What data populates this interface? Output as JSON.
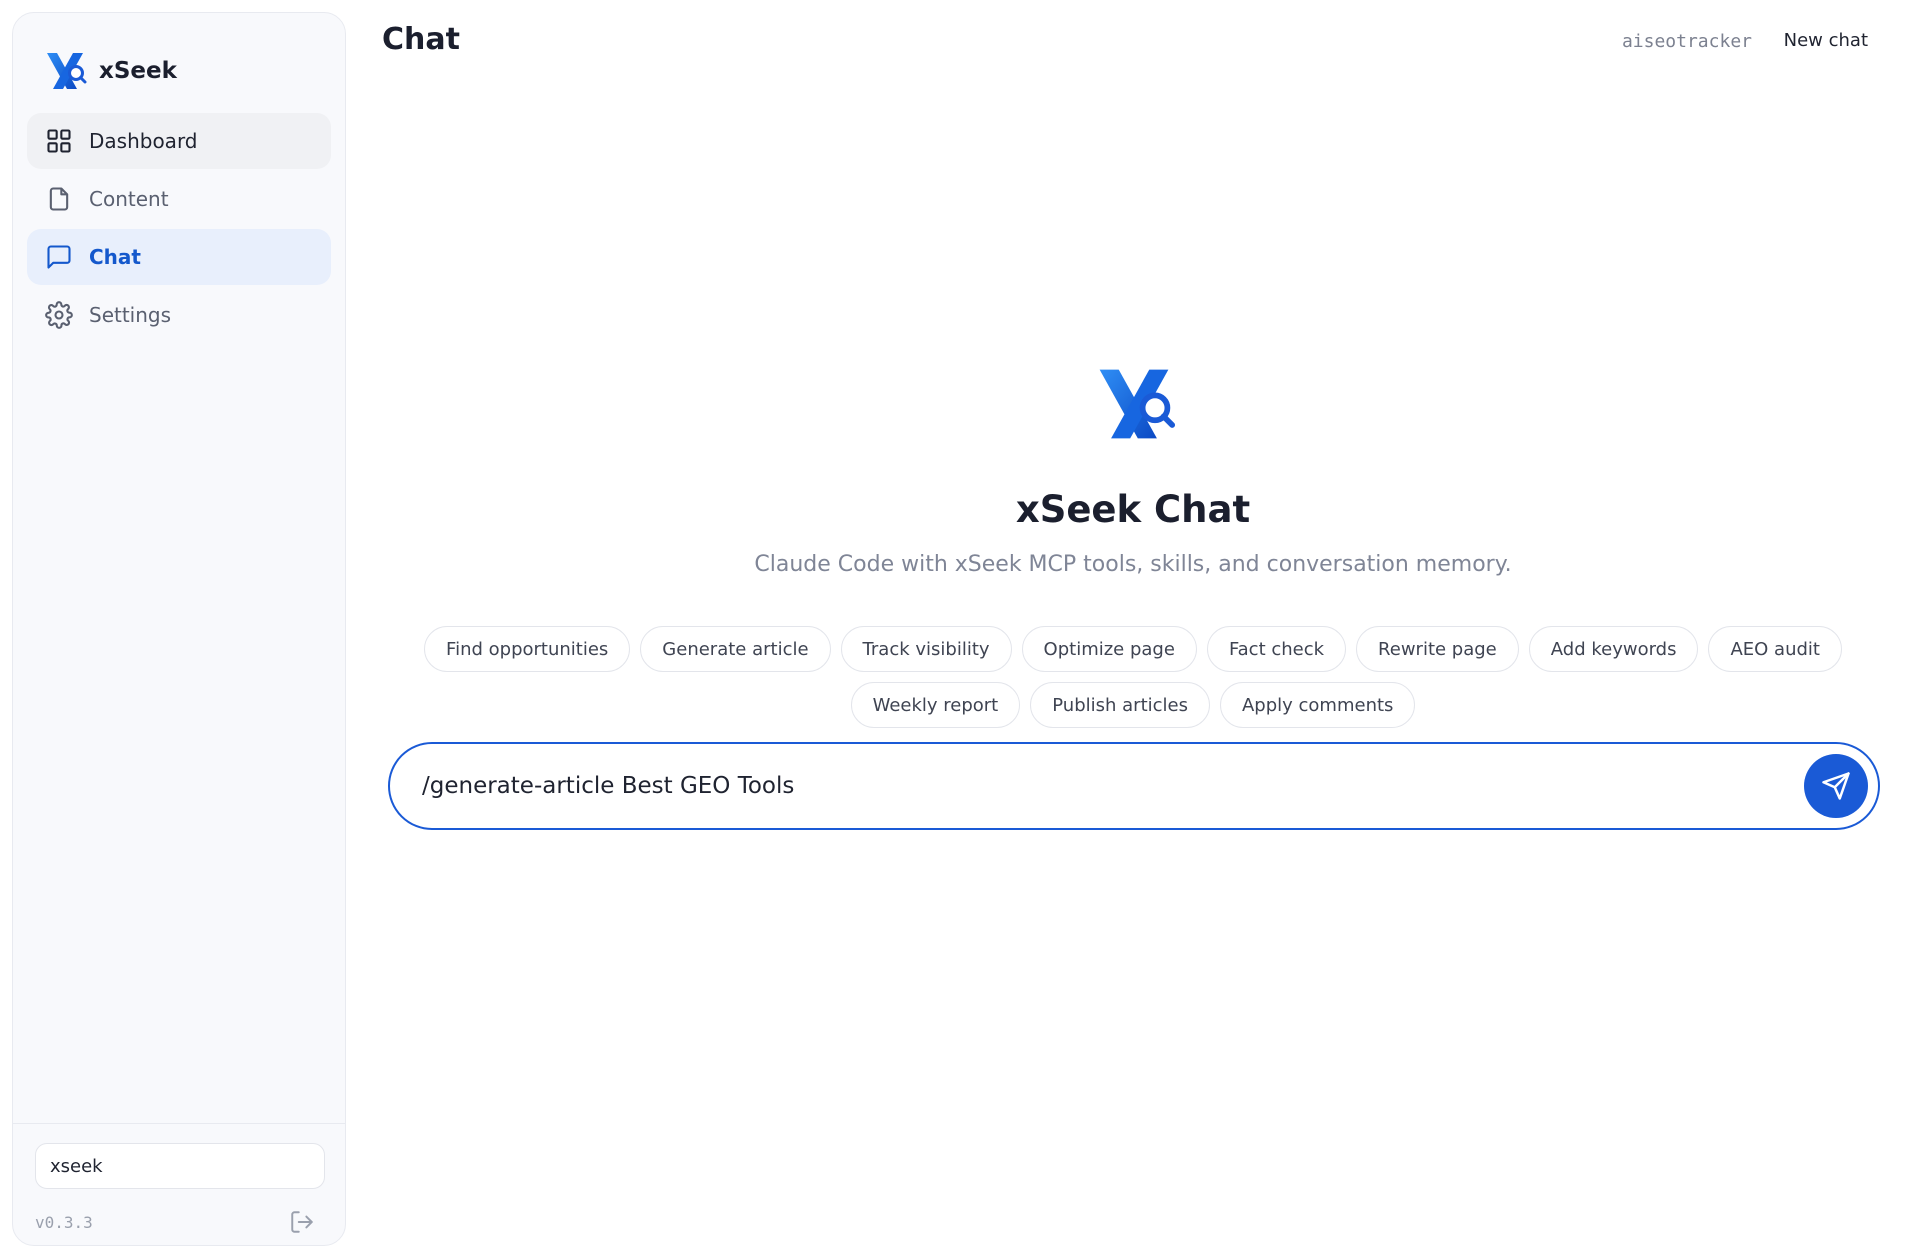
{
  "brand": {
    "name": "xSeek"
  },
  "sidebar": {
    "items": [
      {
        "label": "Dashboard"
      },
      {
        "label": "Content"
      },
      {
        "label": "Chat"
      },
      {
        "label": "Settings"
      }
    ],
    "workspace_value": "xseek",
    "version": "v0.3.3"
  },
  "header": {
    "title": "Chat",
    "project": "aiseotracker",
    "new_chat_label": "New chat"
  },
  "hero": {
    "title": "xSeek Chat",
    "subtitle": "Claude Code with xSeek MCP tools, skills, and conversation memory."
  },
  "suggestions": [
    "Find opportunities",
    "Generate article",
    "Track visibility",
    "Optimize page",
    "Fact check",
    "Rewrite page",
    "Add keywords",
    "AEO audit",
    "Weekly report",
    "Publish articles",
    "Apply comments"
  ],
  "composer": {
    "value": "/generate-article Best GEO Tools"
  },
  "colors": {
    "accent": "#1a5ad6",
    "active_nav_bg": "#e8effc",
    "sidebar_bg": "#f8f9fc"
  },
  "icons": {
    "dashboard": "grid-icon",
    "content": "file-icon",
    "chat": "message-square-icon",
    "settings": "gear-icon",
    "logout": "logout-icon",
    "send": "send-icon"
  }
}
